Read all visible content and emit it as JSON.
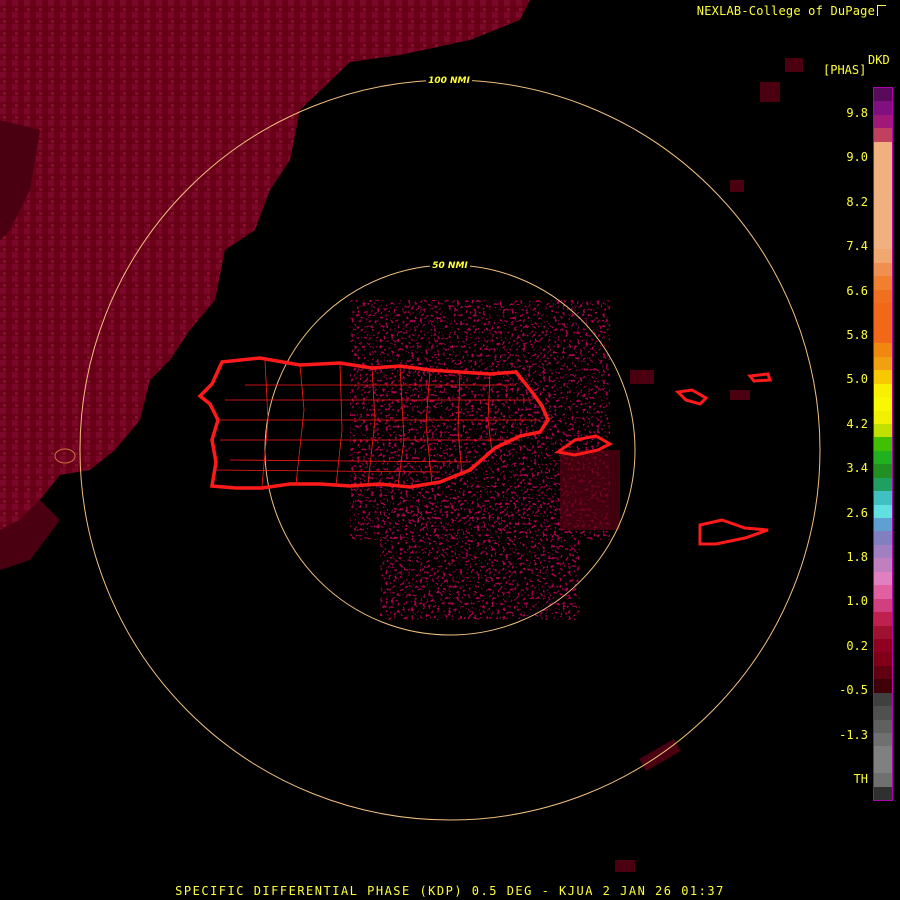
{
  "header": {
    "credit": "NEXLAB-College of DuPage"
  },
  "legend": {
    "product_code": "DKD",
    "units": "[PHAS]",
    "ticks": [
      "9.8",
      "9.0",
      "8.2",
      "7.4",
      "6.6",
      "5.8",
      "5.0",
      "4.2",
      "3.4",
      "2.6",
      "1.8",
      "1.0",
      "0.2",
      "-0.5",
      "-1.3",
      "TH"
    ],
    "colors": [
      "#5a0a5a",
      "#801080",
      "#a01878",
      "#c04060",
      "#f0b080",
      "#f0b080",
      "#f0b080",
      "#f0b080",
      "#f0b080",
      "#f0b080",
      "#f0b080",
      "#f0b080",
      "#f0a870",
      "#f09050",
      "#f08030",
      "#f07020",
      "#f06818",
      "#f06818",
      "#f06818",
      "#f08810",
      "#f0a010",
      "#f8c800",
      "#f8f000",
      "#f8f800",
      "#f0f000",
      "#c0e000",
      "#40c000",
      "#20b020",
      "#209020",
      "#20a060",
      "#40c0c0",
      "#60e0e0",
      "#60a0d0",
      "#8080c0",
      "#a080c0",
      "#c080c0",
      "#e080c0",
      "#e060a0",
      "#d04080",
      "#c02050",
      "#a01030",
      "#900020",
      "#800018",
      "#600010",
      "#400008",
      "#404040",
      "#505050",
      "#606060",
      "#707070",
      "#808080",
      "#808080",
      "#707070",
      "#303030"
    ]
  },
  "map": {
    "range_rings": [
      {
        "label": "50 NMI",
        "radius_nmi": 50
      },
      {
        "label": "100 NMI",
        "radius_nmi": 100
      }
    ],
    "station": "KJUA",
    "boundary_color": "#ff1a1a",
    "ring_color": "#f0c080",
    "echo_color": "#6a0018"
  },
  "footer": {
    "caption": "SPECIFIC DIFFERENTIAL PHASE (KDP) 0.5 DEG - KJUA 2 JAN 26 01:37"
  }
}
